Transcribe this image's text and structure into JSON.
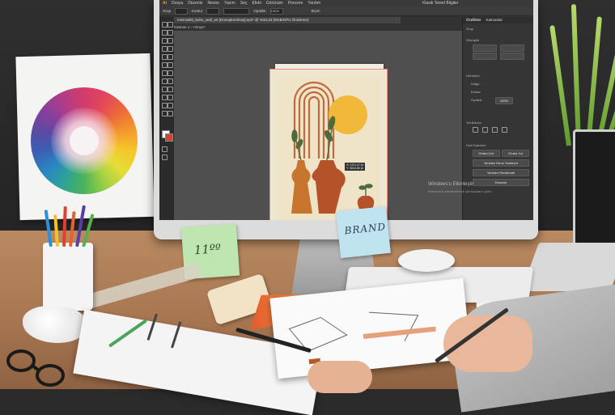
{
  "app": {
    "logo": "Ai",
    "menu": [
      "Dosya",
      "Düzenle",
      "Nesne",
      "Yazım",
      "Seç",
      "Efekt",
      "Görünüm",
      "Pencere",
      "Yardım"
    ],
    "workspace": "Klasik Temel Bilgiler",
    "option_bar": [
      "Grup",
      "Kontur",
      "Opaklık",
      "Biçim"
    ],
    "opacity_value": "100%",
    "document_tab": "minimalist_boho_wall_art [Dönüştürülmüş].eps* @ %33,33 (RGB/GPU Önizleme)",
    "breadcrumb": [
      "Katman 1",
      "<Grup>"
    ],
    "panel_tabs": [
      "Özellikler",
      "Katmanlar"
    ],
    "panel_labels": [
      "Grup",
      "Dönüştür",
      "Görünüm",
      "Dolgu",
      "Kontur",
      "Opaklık",
      "Yol Bulucu",
      "Hızlı Eylemler"
    ],
    "quick_actions": [
      "Gruba Çöz",
      "Gruba Yut",
      "Yeniden Renk Tonlandır",
      "Yeniden Renklendir",
      "Düzenle"
    ],
    "tooltip_lines": [
      "G: 1671,47 pt",
      "Y: 3644,86 pt"
    ],
    "watermark_title": "Windows'u Etkinleştir",
    "watermark_sub": "Windows'u etkinleştirmek için Ayarlar'a gidin."
  },
  "notes": {
    "green": "11ºº",
    "blue": "BRAND"
  },
  "colors": {
    "ui_dark": "#323232",
    "artboard": "#efe6cf",
    "terracotta": "#b4532a",
    "sun": "#f2b83a",
    "leaf": "#4d6b3a"
  }
}
